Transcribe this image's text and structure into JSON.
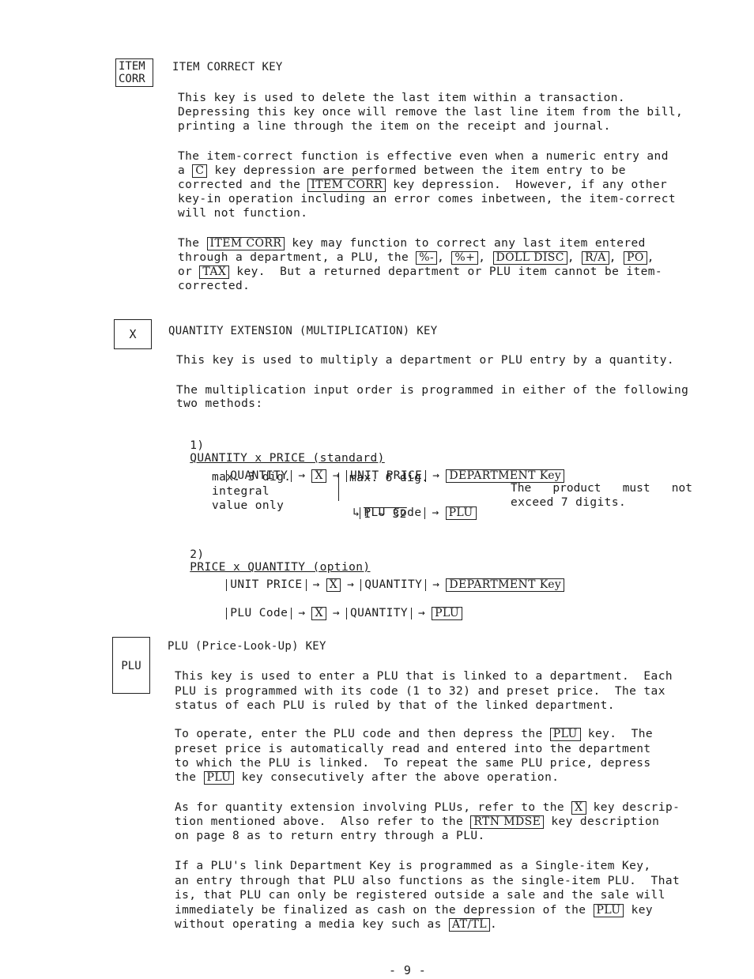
{
  "page_number": "- 9 -",
  "sections": [
    {
      "key_label_lines": [
        "ITEM",
        "CORR"
      ],
      "title": "ITEM CORRECT KEY",
      "paragraphs": [
        [
          "This key is used to delete the last item within a transaction.",
          "Depressing this key once will remove the last line item from the bill,",
          "printing a line through the item on the receipt and journal."
        ],
        [
          "The item-correct function is effective even when a numeric entry and",
          "a [C] key depression are performed between the item entry to be",
          "corrected and the [ITEM CORR] key depression.  However, if any other",
          "key-in operation including an error comes inbetween, the item-correct",
          "will not function."
        ],
        [
          "The [ITEM CORR] key may function to correct any last item entered",
          "through a department, a PLU, the [%-], [%+], [DOLL DISC], [R/A], [PO],",
          "or [TAX] key.  But a returned department or PLU item cannot be item-",
          "corrected."
        ]
      ]
    },
    {
      "key_label": "X",
      "title": "QUANTITY EXTENSION (MULTIPLICATION) KEY",
      "paragraphs": [
        "This key is used to multiply a department or PLU entry by a quantity.",
        "The multiplication input order is programmed in either of the following",
        "two methods:"
      ],
      "method1": {
        "heading_num": "1)",
        "heading": "QUANTITY x PRICE (standard)",
        "quantity": "QUANTITY",
        "x_key": "X",
        "unit_price": "UNIT PRICE",
        "dept_key": "DEPARTMENT Key",
        "qty_notes": [
          "max. 3 dig.",
          "integral",
          "value only"
        ],
        "price_note": "max. 6 dig.",
        "plu_code": "PLU Code",
        "plu_range": "1 ~ 32",
        "plu_key": "PLU",
        "note_line1": [
          "The",
          "product",
          "must",
          "not"
        ],
        "note_line2": "exceed 7 digits."
      },
      "method2": {
        "heading_num": "2)",
        "heading": "PRICE x QUANTITY (option)",
        "row1": [
          "UNIT PRICE",
          "X",
          "QUANTITY",
          "DEPARTMENT Key"
        ],
        "row2": [
          "PLU Code",
          "X",
          "QUANTITY",
          "PLU"
        ]
      },
      "arrow": "→"
    },
    {
      "key_label": "PLU",
      "title": "PLU (Price-Look-Up) KEY",
      "paragraphs": [
        [
          "This key is used to enter a PLU that is linked to a department.  Each",
          "PLU is programmed with its code (1 to 32) and preset price.  The tax",
          "status of each PLU is ruled by that of the linked department."
        ],
        [
          "To operate, enter the PLU code and then depress the [PLU] key.  The",
          "preset price is automatically read and entered into the department",
          "to which the PLU is linked.  To repeat the same PLU price, depress",
          "the [PLU] key consecutively after the above operation."
        ],
        [
          "As for quantity extension involving PLUs, refer to the [X] key descrip-",
          "tion mentioned above.  Also refer to the [RTN MDSE] key description",
          "on page 8 as to return entry through a PLU."
        ],
        [
          "If a PLU's link Department Key is programmed as a Single-item Key,",
          "an entry through that PLU also functions as the single-item PLU.  That",
          "is, that PLU can only be registered outside a sale and the sale will",
          "immediately be finalized as cash on the depression of the [PLU] key",
          "without operating a media key such as [AT/TL]."
        ]
      ]
    }
  ]
}
